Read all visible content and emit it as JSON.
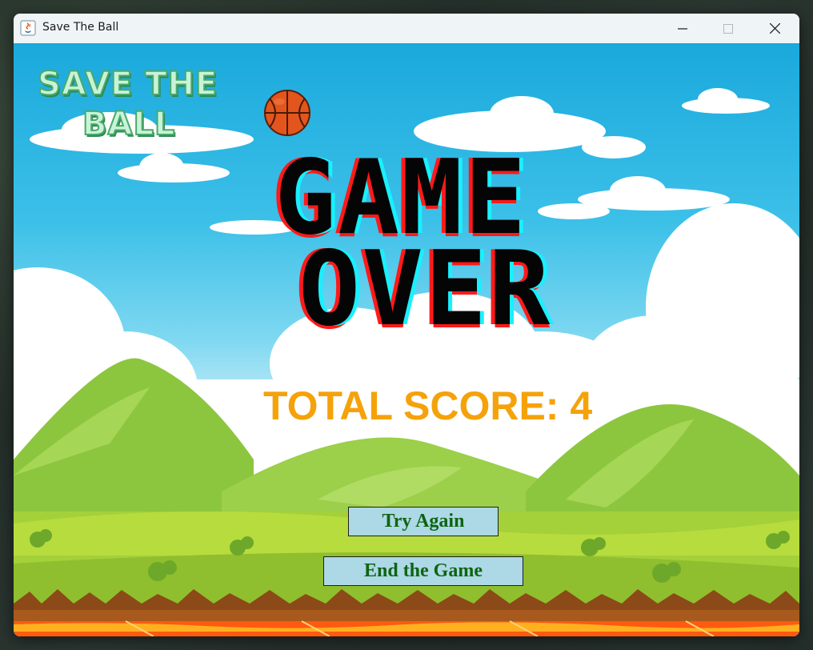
{
  "window": {
    "title": "Save The Ball",
    "icon": "java-app-icon",
    "controls": [
      "minimize-icon",
      "maximize-icon",
      "close-icon"
    ]
  },
  "game": {
    "logo": {
      "line1": "SAVE THE",
      "line2": "BALL",
      "icon": "basketball-icon"
    },
    "heading": {
      "line1": "GAME",
      "line2": "OVER"
    },
    "score_text": "TOTAL SCORE: 4",
    "score_value": 4,
    "buttons": {
      "try_again": "Try Again",
      "end_game": "End the Game"
    }
  },
  "colors": {
    "score": "#f5a20a",
    "button_bg": "#add8e6",
    "button_text": "#0e6410",
    "glitch_red": "#ff1a1a",
    "glitch_cyan": "#19f0ff"
  }
}
